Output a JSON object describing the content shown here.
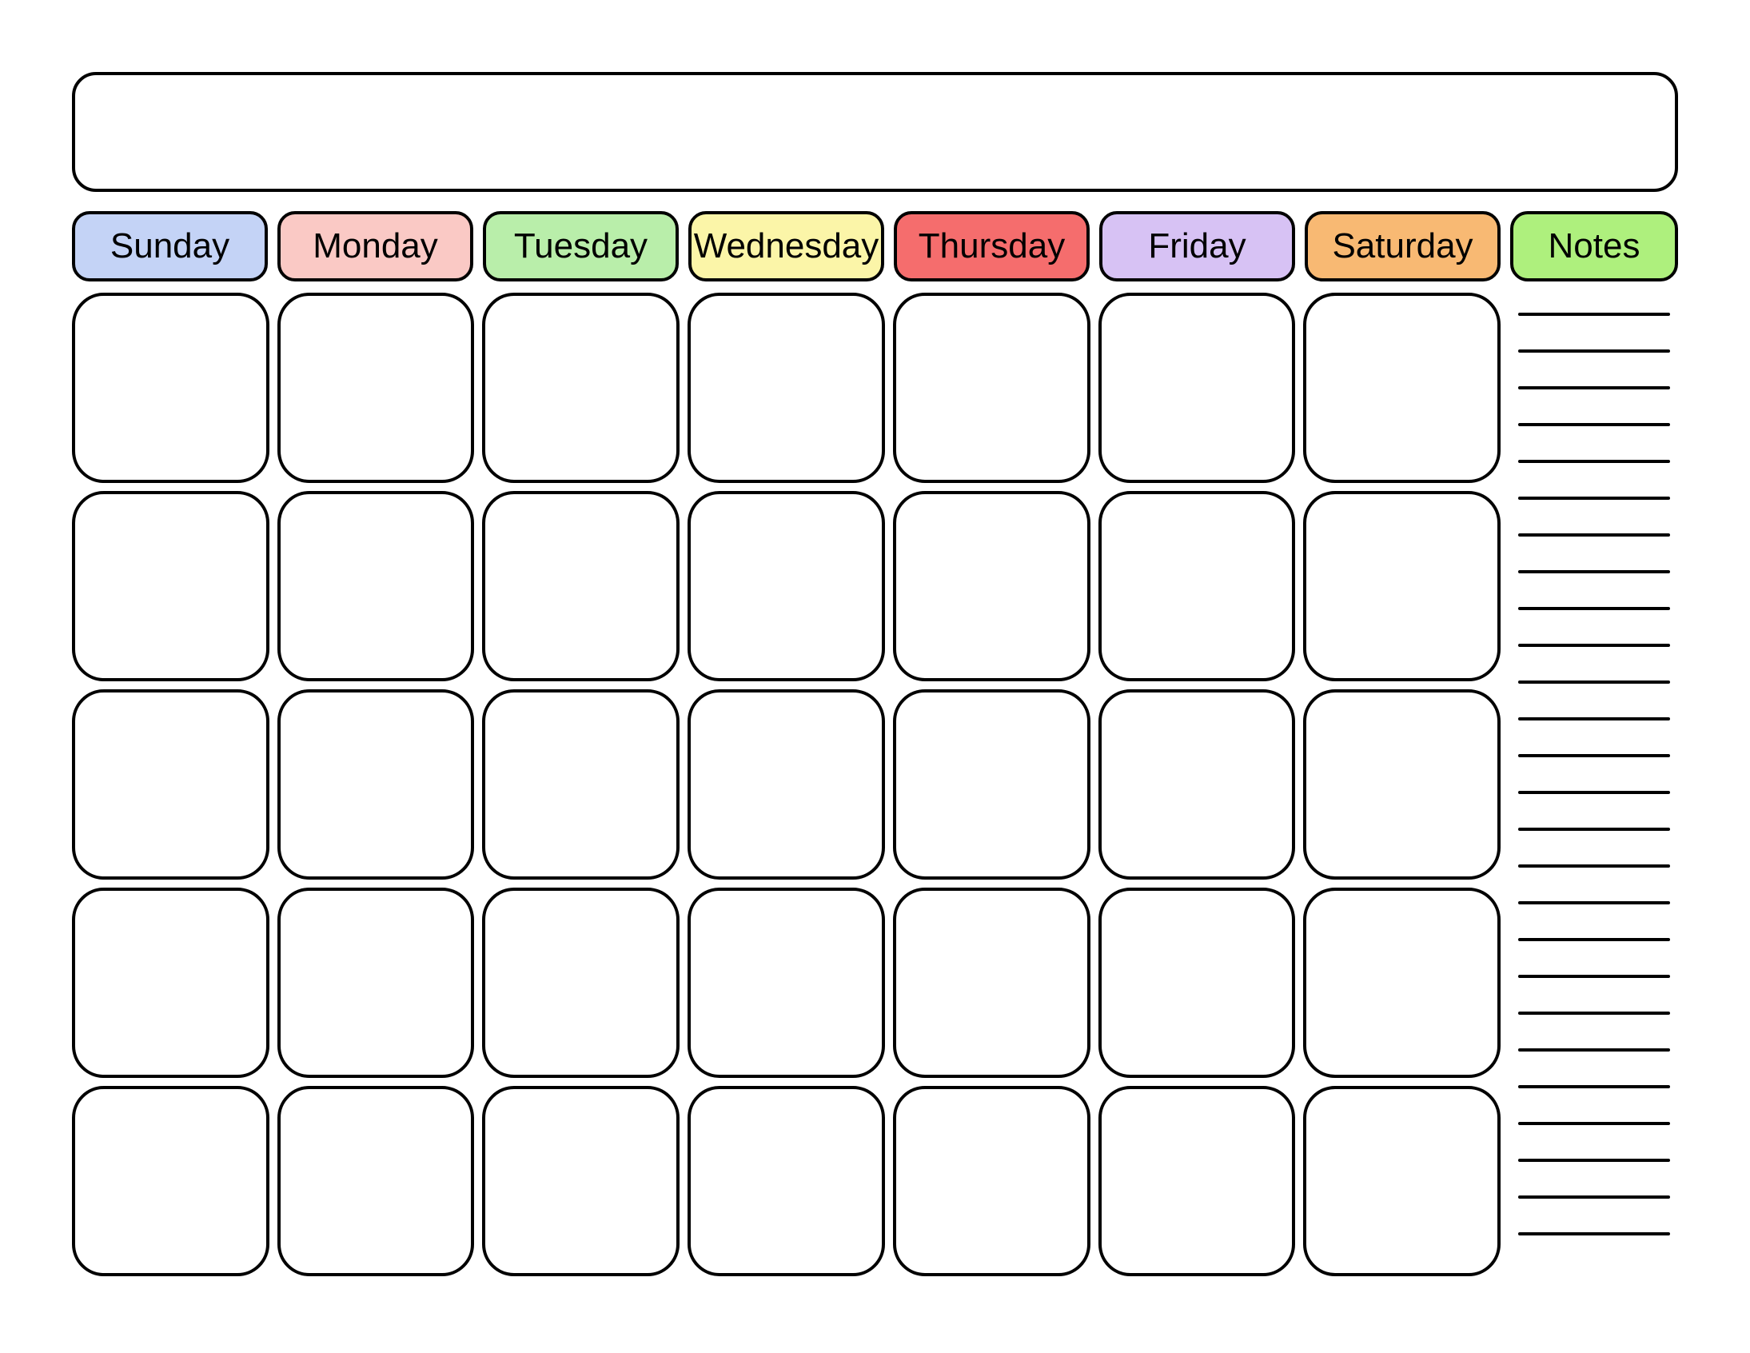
{
  "headers": {
    "days": [
      {
        "label": "Sunday",
        "color": "#c4d3f6"
      },
      {
        "label": "Monday",
        "color": "#fac9c5"
      },
      {
        "label": "Tuesday",
        "color": "#b9eeaa"
      },
      {
        "label": "Wednesday",
        "color": "#fbf5a8"
      },
      {
        "label": "Thursday",
        "color": "#f56d6d"
      },
      {
        "label": "Friday",
        "color": "#d7c2f4"
      },
      {
        "label": "Saturday",
        "color": "#f8b973"
      }
    ],
    "notes": {
      "label": "Notes",
      "color": "#aef07d"
    }
  },
  "grid": {
    "rows": 5,
    "cols": 7
  },
  "notes_lines": 26
}
